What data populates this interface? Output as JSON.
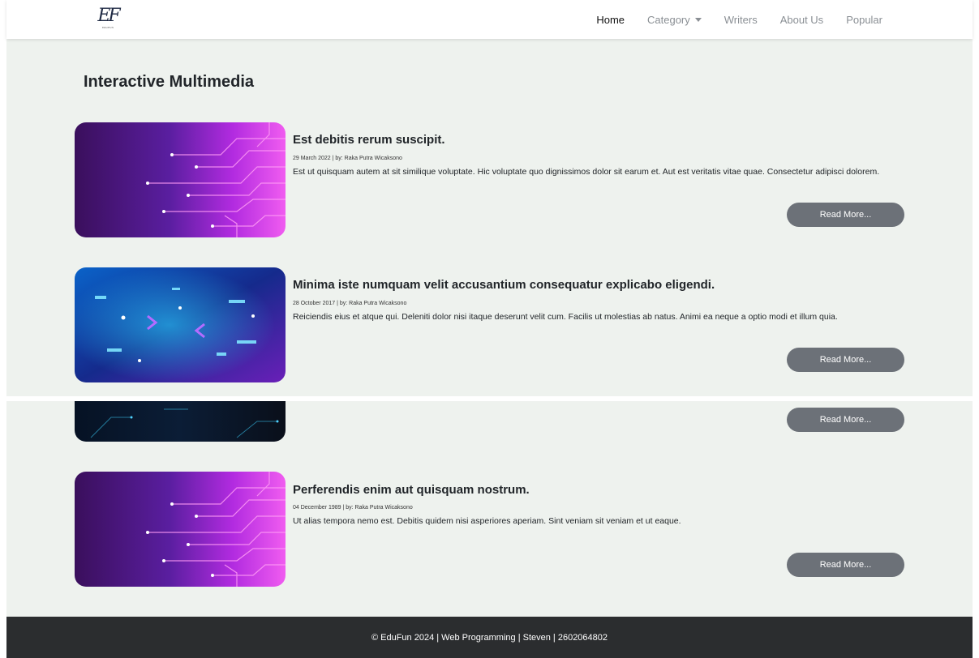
{
  "brand": {
    "logo_text": "EF",
    "logo_subtext": "EDUFUN"
  },
  "nav": {
    "items": [
      {
        "label": "Home",
        "active": true
      },
      {
        "label": "Category",
        "dropdown": true
      },
      {
        "label": "Writers"
      },
      {
        "label": "About Us"
      },
      {
        "label": "Popular"
      }
    ]
  },
  "page": {
    "title": "Interactive Multimedia"
  },
  "articles": [
    {
      "image": "circuit-pink-image",
      "title": "Est debitis rerum suscipit.",
      "meta": "29 March 2022 | by: Raka Putra Wicaksono",
      "excerpt": "Est ut quisquam autem at sit similique voluptate. Hic voluptate quo dignissimos dolor sit earum et. Aut est veritatis vitae quae. Consectetur adipisci dolorem.",
      "button": "Read More..."
    },
    {
      "image": "circuit-blue-image",
      "title": "Minima iste numquam velit accusantium consequatur explicabo eligendi.",
      "meta": "28 October 2017 | by: Raka Putra Wicaksono",
      "excerpt": "Reiciendis eius et atque qui. Deleniti dolor nisi itaque deserunt velit cum. Facilis ut molestias ab natus. Animi ea neque a optio modi et illum quia.",
      "button": "Read More..."
    },
    {
      "image": "circuit-dark-image",
      "button": "Read More..."
    },
    {
      "image": "circuit-pink-image",
      "title": "Perferendis enim aut quisquam nostrum.",
      "meta": "04 December 1989 | by: Raka Putra Wicaksono",
      "excerpt": "Ut alias tempora nemo est. Debitis quidem nisi asperiores aperiam. Sint veniam sit veniam et ut eaque.",
      "button": "Read More..."
    }
  ],
  "footer": {
    "text": "© EduFun 2024 | Web Programming | Steven | 2602064802"
  },
  "colors": {
    "background": "#eef2ee",
    "button": "#6c7178",
    "footer": "#2b2d2f",
    "accent_pink": "#e040fb",
    "accent_blue": "#1e88e5"
  }
}
